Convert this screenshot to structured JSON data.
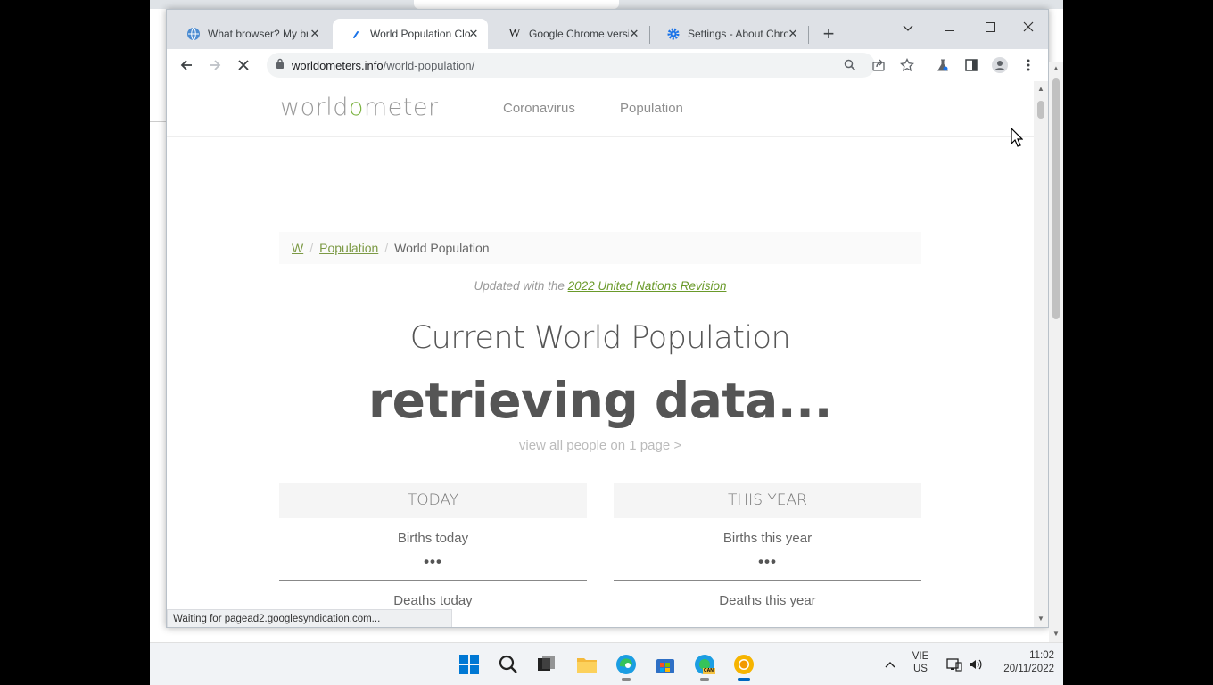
{
  "tabs": [
    {
      "title": "What browser? My browser?",
      "favicon": "globe-icon",
      "active": false
    },
    {
      "title": "World Population Clock",
      "favicon": "loading-icon",
      "active": true
    },
    {
      "title": "Google Chrome version history",
      "favicon": "wikipedia-icon",
      "active": false
    },
    {
      "title": "Settings - About Chrome",
      "favicon": "settings-gear-icon",
      "active": false
    }
  ],
  "address_bar": {
    "domain": "worldometers.info",
    "path": "/world-population/"
  },
  "site": {
    "logo_pre": "world",
    "logo_o": "o",
    "logo_post": "meter",
    "nav": [
      "Coronavirus",
      "Population"
    ]
  },
  "breadcrumb": {
    "home": "W",
    "section": "Population",
    "current": "World Population",
    "separator": "/"
  },
  "updated": {
    "prefix": "Updated with the ",
    "link": "2022 United Nations Revision"
  },
  "main": {
    "title": "Current World Population",
    "counter": "retrieving data...",
    "view_all": "view all people on 1 page >"
  },
  "stats": {
    "today": {
      "heading": "TODAY",
      "births": "Births today",
      "births_value": "•••",
      "deaths": "Deaths today"
    },
    "this_year": {
      "heading": "THIS YEAR",
      "births": "Births this year",
      "births_value": "•••",
      "deaths": "Deaths this year"
    }
  },
  "status": "Waiting for pagead2.googlesyndication.com...",
  "taskbar": {
    "lang_top": "VIE",
    "lang_bottom": "US",
    "time": "11:02",
    "date": "20/11/2022",
    "can_badge": "CAN"
  },
  "colors": {
    "accent_green": "#7cb342",
    "link_green": "#6a9a2a",
    "chrome_tabbar": "#dee1e6"
  }
}
